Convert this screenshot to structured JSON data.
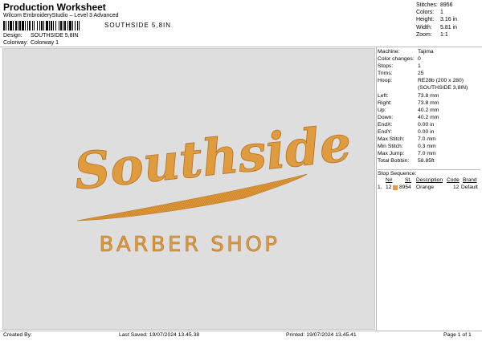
{
  "header": {
    "title": "Production Worksheet",
    "subtitle": "Wilcom EmbroideryStudio – Level 3 Advanced",
    "barcode_text": "SOUTHSIDE 5,8IN"
  },
  "design_info": {
    "design_label": "Design:",
    "design_value": "SOUTHSIDE 5,8IN",
    "colorway_label": "Colorway:",
    "colorway_value": "Colorway 1"
  },
  "summary": [
    {
      "label": "Stitches:",
      "value": "8956"
    },
    {
      "label": "Colors:",
      "value": "1"
    },
    {
      "label": "Height:",
      "value": "3.16 in"
    },
    {
      "label": "Width:",
      "value": "5.81 in"
    },
    {
      "label": "Zoom:",
      "value": "1:1"
    }
  ],
  "artwork": {
    "script_text": "Southside",
    "block_text": "BARBER SHOP",
    "thread_color": "#e09a3e",
    "thread_dark": "#b87520",
    "canvas_bg": "#dedede"
  },
  "properties": [
    {
      "label": "Machine:",
      "value": "Tajima"
    },
    {
      "label": "Color changes:",
      "value": "0"
    },
    {
      "label": "Stops:",
      "value": "1"
    },
    {
      "label": "Trims:",
      "value": "25"
    },
    {
      "label": "Hoop:",
      "value": "RE28b (200 x 280)"
    },
    {
      "label": "",
      "value": "(SOUTHSIDE 3,8IN)"
    },
    {
      "label": "Left:",
      "value": "73.8 mm"
    },
    {
      "label": "Right:",
      "value": "73.8 mm"
    },
    {
      "label": "Up:",
      "value": "40.2 mm"
    },
    {
      "label": "Down:",
      "value": "40.2 mm"
    },
    {
      "label": "EndX:",
      "value": "0.00 in"
    },
    {
      "label": "EndY:",
      "value": "0.00 in"
    },
    {
      "label": "Max Stitch:",
      "value": "7.0 mm"
    },
    {
      "label": "Min Stitch:",
      "value": "0.3 mm"
    },
    {
      "label": "Max Jump:",
      "value": "7.0 mm"
    },
    {
      "label": "Total Bobbin:",
      "value": "58.85ft"
    }
  ],
  "stop_sequence": {
    "heading": "Stop Sequence:",
    "columns": {
      "n": "N#",
      "st": "St.",
      "description": "Description",
      "code": "Code",
      "brand": "Brand"
    },
    "rows": [
      {
        "index": "1.",
        "n": "12",
        "swatch": "#e49a47",
        "st": "8954",
        "description": "Orange",
        "code": "12",
        "brand": "Default"
      }
    ]
  },
  "footer": {
    "created": "Created By:",
    "last_saved": "Last Saved: 19/07/2024 13.45.38",
    "printed": "Printed: 19/07/2024 13.45.41",
    "page": "Page 1 of 1"
  }
}
